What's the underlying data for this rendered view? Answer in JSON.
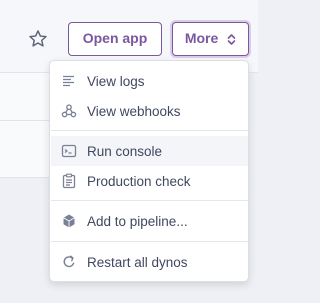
{
  "toolbar": {
    "open_app_label": "Open app",
    "more_label": "More"
  },
  "menu": {
    "items": [
      {
        "label": "View logs",
        "icon": "logs-icon"
      },
      {
        "label": "View webhooks",
        "icon": "webhooks-icon"
      },
      {
        "label": "Run console",
        "icon": "console-icon"
      },
      {
        "label": "Production check",
        "icon": "clipboard-icon"
      },
      {
        "label": "Add to pipeline...",
        "icon": "pipeline-icon"
      },
      {
        "label": "Restart all dynos",
        "icon": "restart-icon"
      }
    ]
  },
  "colors": {
    "accent": "#79589f",
    "text": "#3f4860",
    "icon": "#7a8095",
    "background": "#eef0f5"
  }
}
